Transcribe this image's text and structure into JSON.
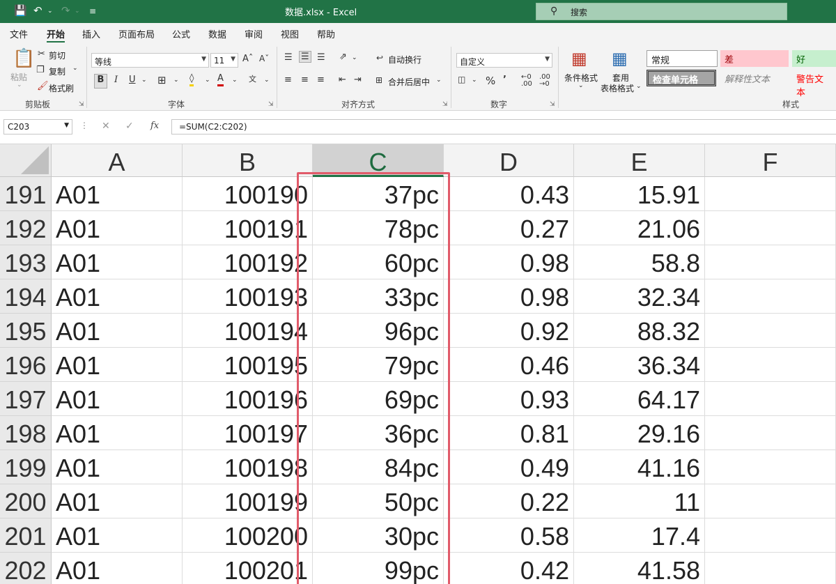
{
  "window": {
    "title": "数据.xlsx  -  Excel",
    "search_placeholder": "搜索"
  },
  "menu": [
    "文件",
    "开始",
    "插入",
    "页面布局",
    "公式",
    "数据",
    "审阅",
    "视图",
    "帮助"
  ],
  "ribbon": {
    "clipboard": {
      "paste": "粘贴",
      "cut": "剪切",
      "copy": "复制",
      "format_painter": "格式刷",
      "label": "剪贴板"
    },
    "font": {
      "name": "等线",
      "size": "11",
      "label": "字体"
    },
    "alignment": {
      "wrap_text": "自动换行",
      "merge_center": "合并后居中",
      "label": "对齐方式"
    },
    "number": {
      "format": "自定义",
      "label": "数字"
    },
    "styles": {
      "conditional_format": "条件格式",
      "table_format_line1": "套用",
      "table_format_line2": "表格格式",
      "normal": "常规",
      "bad": "差",
      "good": "好",
      "check_cell": "检查单元格",
      "explanatory": "解释性文本",
      "warning": "警告文本",
      "label": "样式"
    }
  },
  "formula_bar": {
    "name_box": "C203",
    "formula": "=SUM(C2:C202)"
  },
  "columns": [
    "A",
    "B",
    "C",
    "D",
    "E",
    "F"
  ],
  "selected_column": "C",
  "rows": [
    {
      "row": "191",
      "a": "A01",
      "b": "100190",
      "c": "37pc",
      "d": "0.43",
      "e": "15.91"
    },
    {
      "row": "192",
      "a": "A01",
      "b": "100191",
      "c": "78pc",
      "d": "0.27",
      "e": "21.06"
    },
    {
      "row": "193",
      "a": "A01",
      "b": "100192",
      "c": "60pc",
      "d": "0.98",
      "e": "58.8"
    },
    {
      "row": "194",
      "a": "A01",
      "b": "100193",
      "c": "33pc",
      "d": "0.98",
      "e": "32.34"
    },
    {
      "row": "195",
      "a": "A01",
      "b": "100194",
      "c": "96pc",
      "d": "0.92",
      "e": "88.32"
    },
    {
      "row": "196",
      "a": "A01",
      "b": "100195",
      "c": "79pc",
      "d": "0.46",
      "e": "36.34"
    },
    {
      "row": "197",
      "a": "A01",
      "b": "100196",
      "c": "69pc",
      "d": "0.93",
      "e": "64.17"
    },
    {
      "row": "198",
      "a": "A01",
      "b": "100197",
      "c": "36pc",
      "d": "0.81",
      "e": "29.16"
    },
    {
      "row": "199",
      "a": "A01",
      "b": "100198",
      "c": "84pc",
      "d": "0.49",
      "e": "41.16"
    },
    {
      "row": "200",
      "a": "A01",
      "b": "100199",
      "c": "50pc",
      "d": "0.22",
      "e": "11"
    },
    {
      "row": "201",
      "a": "A01",
      "b": "100200",
      "c": "30pc",
      "d": "0.58",
      "e": "17.4"
    },
    {
      "row": "202",
      "a": "A01",
      "b": "100201",
      "c": "99pc",
      "d": "0.42",
      "e": "41.58"
    }
  ],
  "colors": {
    "excel_green": "#217346",
    "highlight_border": "#e15b6a"
  }
}
